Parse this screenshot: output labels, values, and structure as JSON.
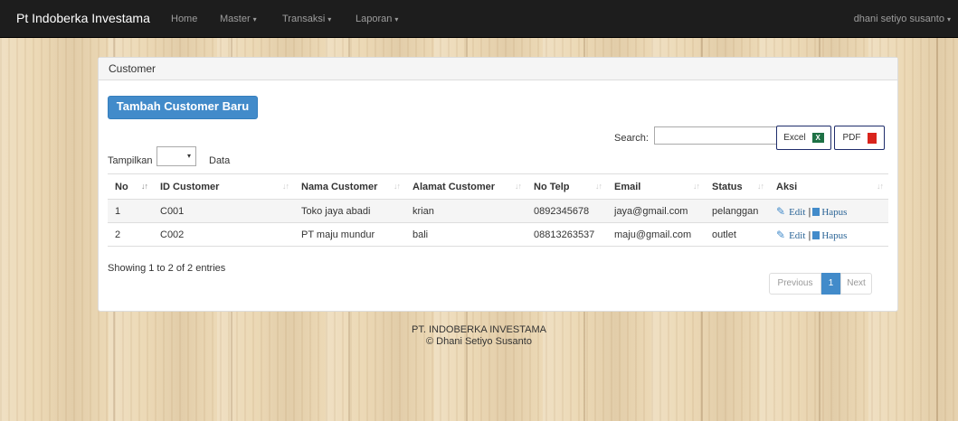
{
  "navbar": {
    "brand": "Pt Indoberka Investama",
    "items": [
      {
        "label": "Home",
        "caret": ""
      },
      {
        "label": "Master",
        "caret": "▾"
      },
      {
        "label": "Transaksi",
        "caret": "▾"
      },
      {
        "label": "Laporan",
        "caret": "▾"
      }
    ],
    "user": "dhani setiyo susanto",
    "user_caret": "▾"
  },
  "panel": {
    "heading": "Customer",
    "add_button": "Tambah Customer Baru"
  },
  "controls": {
    "search_label": "Search:",
    "search_value": "",
    "excel_label": "Excel",
    "excel_icon": "X",
    "pdf_label": "PDF",
    "pdf_icon": "PDF",
    "show_label": "Tampilkan",
    "show_value": "",
    "show_arrow": "▾",
    "data_label": "Data"
  },
  "table": {
    "columns": [
      "No",
      "ID Customer",
      "Nama Customer",
      "Alamat Customer",
      "No Telp",
      "Email",
      "Status",
      "Aksi"
    ],
    "rows": [
      {
        "no": "1",
        "id": "C001",
        "nama": "Toko jaya abadi",
        "alamat": "krian",
        "telp": "0892345678",
        "email": "jaya@gmail.com",
        "status": "pelanggan"
      },
      {
        "no": "2",
        "id": "C002",
        "nama": "PT maju mundur",
        "alamat": "bali",
        "telp": "08813263537",
        "email": "maju@gmail.com",
        "status": "outlet"
      }
    ],
    "edit_label": "Edit",
    "separator": "|",
    "delete_label": "Hapus",
    "sort_glyph": "↓↑"
  },
  "info": "Showing 1 to 2 of 2 entries",
  "pagination": {
    "previous": "Previous",
    "current": "1",
    "next": "Next"
  },
  "footer": {
    "line1": "PT. INDOBERKA INVESTAMA",
    "line2": "© Dhani Setiyo Susanto"
  },
  "icons": {
    "pencil": "pencil-icon",
    "trash": "trash-icon",
    "excel": "excel-icon",
    "pdf": "pdf-icon",
    "caret": "caret-down-icon"
  },
  "colors": {
    "navbar": "#1d1d1d",
    "primary": "#428bca",
    "excel": "#1e7145",
    "pdf": "#d9241c"
  }
}
